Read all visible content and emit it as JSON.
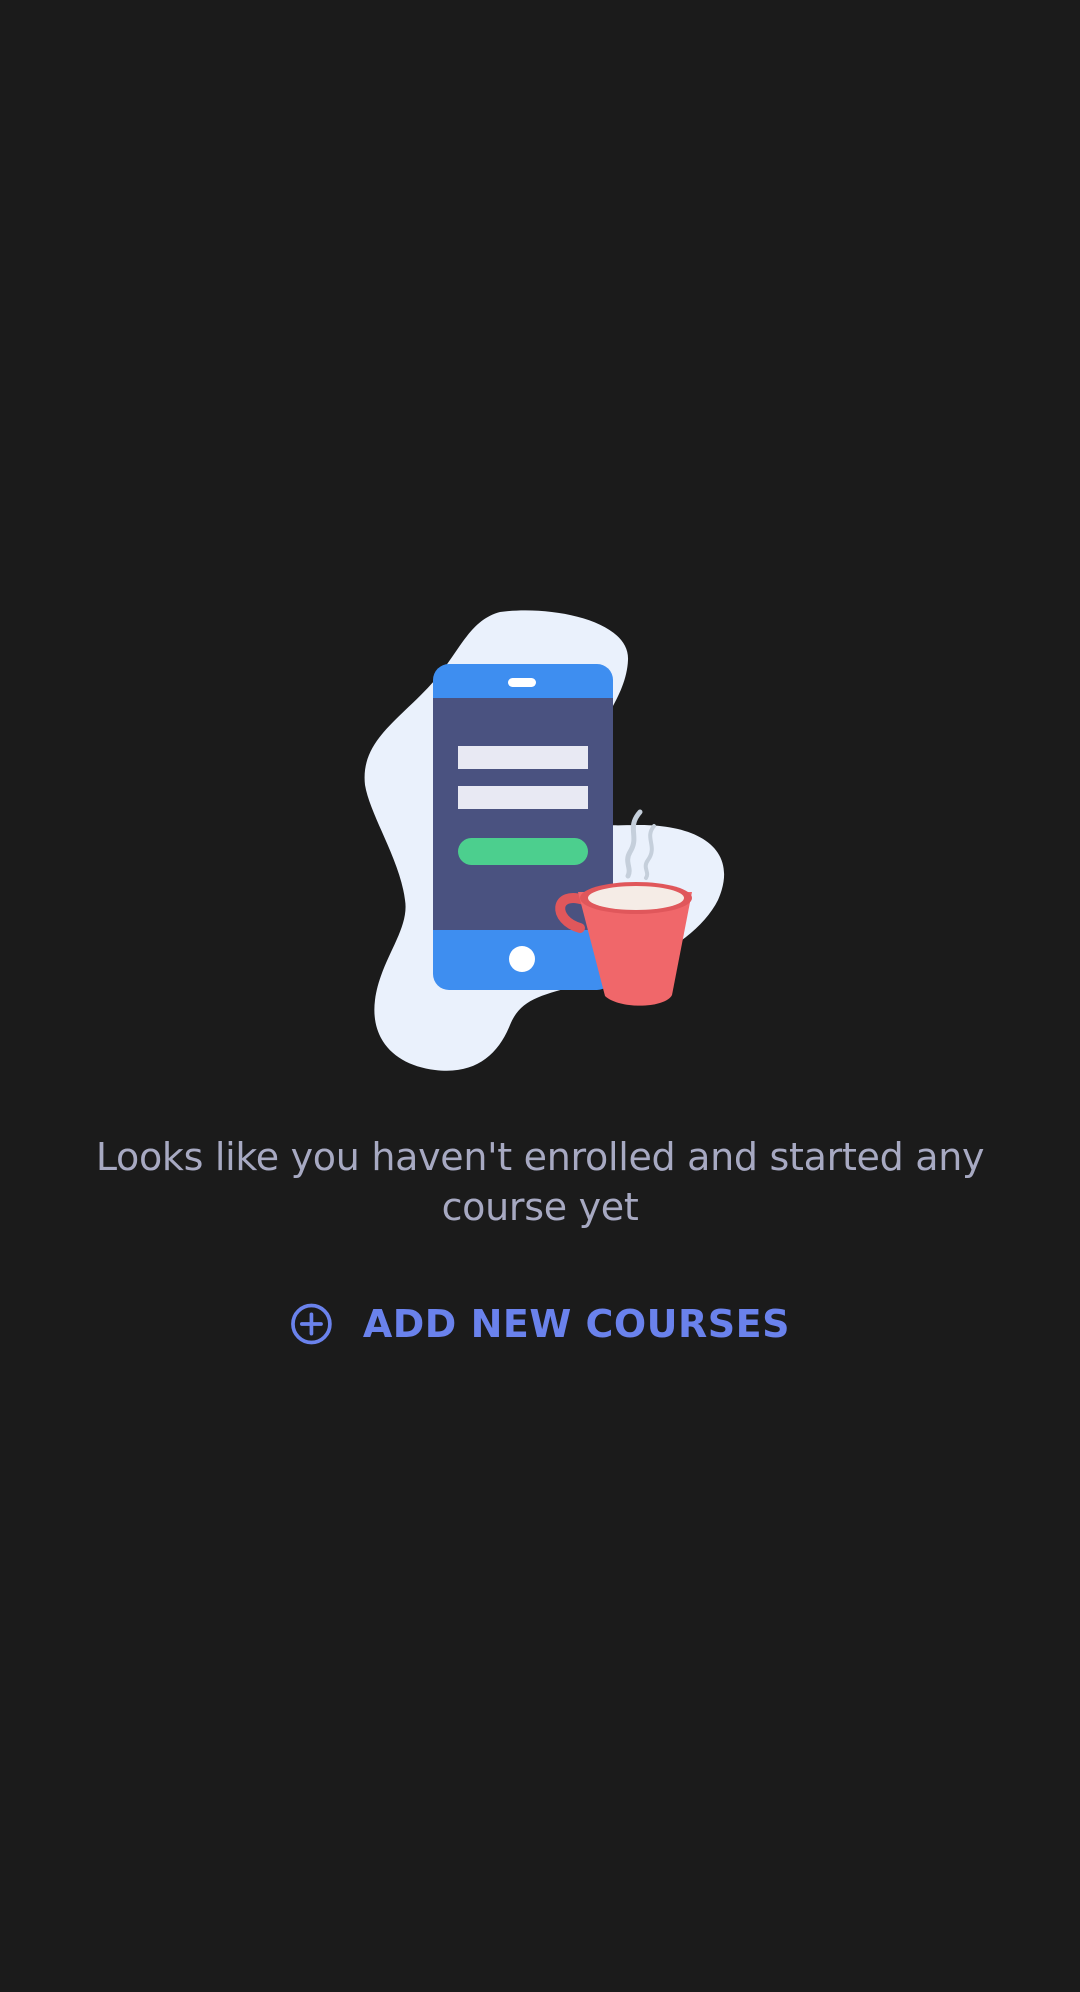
{
  "empty_state": {
    "illustration": {
      "icon": "phone-with-coffee-illustration",
      "colors": {
        "blob": "#eaf1fc",
        "phone_frame": "#3e8ef0",
        "phone_screen": "#4a5280",
        "form_field": "#e8e9f3",
        "form_button": "#4ccf8e",
        "cup": "#f0676a",
        "cup_rim": "#f5ece6",
        "steam": "#c5cfdb"
      }
    },
    "message": "Looks like you haven't enrolled and started any course yet",
    "add_button": {
      "icon": "plus-circle-icon",
      "label": "ADD NEW COURSES"
    }
  },
  "theme": {
    "background": "#1b1b1b",
    "message_text": "#a7a9c2",
    "accent": "#6a82ec"
  }
}
